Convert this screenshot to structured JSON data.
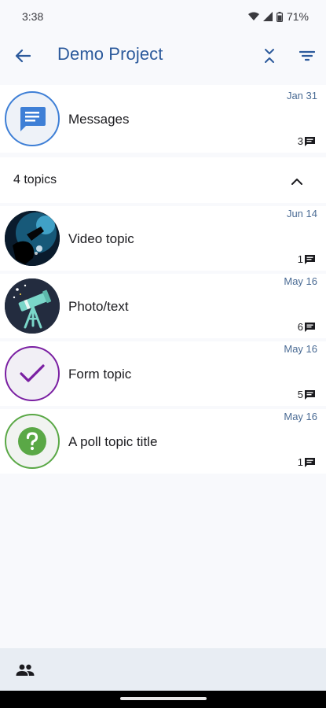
{
  "status_bar": {
    "time": "3:38",
    "battery": "71%"
  },
  "app_bar": {
    "title": "Demo Project",
    "back_icon": "arrow-back-icon",
    "collapse_icon": "unfold-less-icon",
    "filter_icon": "filter-icon"
  },
  "messages": {
    "title": "Messages",
    "date": "Jan 31",
    "count": "3",
    "icon": "chat-bubble-icon",
    "accent": "#3e7fd6"
  },
  "section": {
    "label": "4 topics",
    "toggle_icon": "chevron-up-icon"
  },
  "topics": [
    {
      "title": "Video topic",
      "date": "Jun 14",
      "count": "1",
      "icon": "video-thumbnail"
    },
    {
      "title": "Photo/text",
      "date": "May 16",
      "count": "6",
      "icon": "telescope-icon"
    },
    {
      "title": "Form topic",
      "date": "May 16",
      "count": "5",
      "icon": "check-icon",
      "accent": "#7a1fa2"
    },
    {
      "title": "A poll topic title",
      "date": "May 16",
      "count": "1",
      "icon": "question-icon",
      "accent": "#5aa846"
    }
  ],
  "bottom_bar": {
    "icon": "people-icon"
  },
  "colors": {
    "title": "#2c5a9c",
    "date": "#4a6b94",
    "background": "#f8f9fc"
  }
}
